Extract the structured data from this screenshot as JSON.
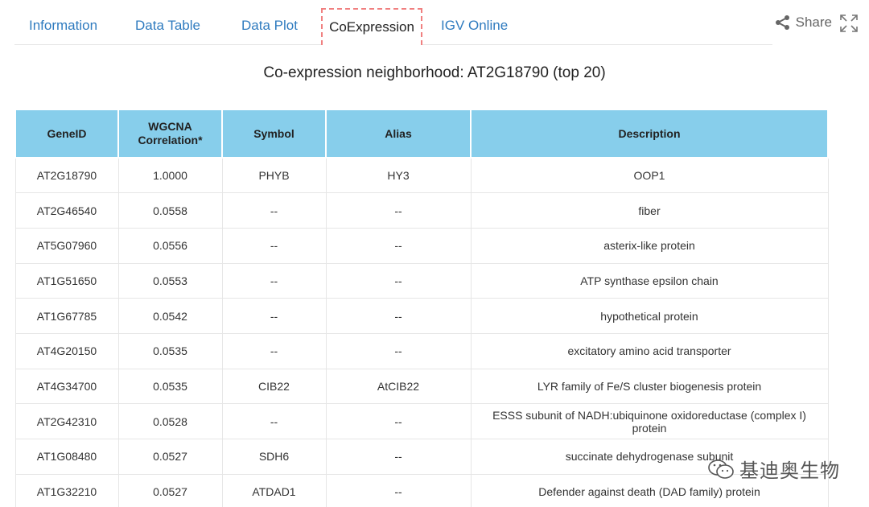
{
  "tabs": [
    {
      "label": "Information"
    },
    {
      "label": "Data Table"
    },
    {
      "label": "Data Plot"
    },
    {
      "label": "CoExpression",
      "active": true
    },
    {
      "label": "IGV Online"
    }
  ],
  "share": {
    "label": "Share",
    "icon": "share-icon"
  },
  "expand": {
    "icon": "fullscreen-icon"
  },
  "title": "Co-expression neighborhood: AT2G18790 (top 20)",
  "table": {
    "headers": [
      "GeneID",
      "WGCNA Correlation*",
      "Symbol",
      "Alias",
      "Description"
    ],
    "rows": [
      [
        "AT2G18790",
        "1.0000",
        "PHYB",
        "HY3",
        "OOP1"
      ],
      [
        "AT2G46540",
        "0.0558",
        "--",
        "--",
        "fiber"
      ],
      [
        "AT5G07960",
        "0.0556",
        "--",
        "--",
        "asterix-like protein"
      ],
      [
        "AT1G51650",
        "0.0553",
        "--",
        "--",
        "ATP synthase epsilon chain"
      ],
      [
        "AT1G67785",
        "0.0542",
        "--",
        "--",
        "hypothetical protein"
      ],
      [
        "AT4G20150",
        "0.0535",
        "--",
        "--",
        "excitatory amino acid transporter"
      ],
      [
        "AT4G34700",
        "0.0535",
        "CIB22",
        "AtCIB22",
        "LYR family of Fe/S cluster biogenesis protein"
      ],
      [
        "AT2G42310",
        "0.0528",
        "--",
        "--",
        "ESSS subunit of NADH:ubiquinone oxidoreductase (complex I) protein"
      ],
      [
        "AT1G08480",
        "0.0527",
        "SDH6",
        "--",
        "succinate dehydrogenase subunit"
      ],
      [
        "AT1G32210",
        "0.0527",
        "ATDAD1",
        "--",
        "Defender against death (DAD family) protein"
      ]
    ]
  },
  "watermark": {
    "text": "基迪奥生物",
    "icon": "wechat-icon"
  },
  "colors": {
    "header_bg": "#87ceeb",
    "tab_link": "#2f7bbf",
    "active_tab_border": "#f08080"
  }
}
